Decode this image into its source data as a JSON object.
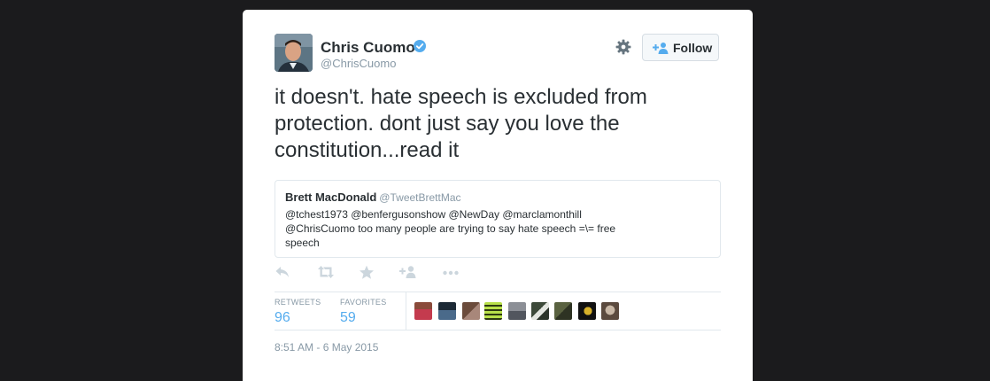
{
  "user": {
    "name": "Chris Cuomo",
    "handle": "@ChrisCuomo",
    "verified": true
  },
  "buttons": {
    "follow_label": "Follow"
  },
  "icons": {
    "settings": "gear-icon",
    "follow": "add-user-icon",
    "verified": "verified-badge-icon",
    "actions": [
      "reply-icon",
      "retweet-icon",
      "favorite-star-icon",
      "add-user-icon",
      "more-dots-icon"
    ]
  },
  "tweet": {
    "text": "it doesn't. hate speech is excluded from protection. dont just say you love the constitution...read it",
    "timestamp": "8:51 AM - 6 May 2015"
  },
  "quoted_tweet": {
    "name": "Brett MacDonald",
    "handle": "@TweetBrettMac",
    "text": "@tchest1973 @benfergusonshow @NewDay @marclamonthill @ChrisCuomo too many people are trying to say hate speech =\\= free speech"
  },
  "stats": {
    "retweets_label": "RETWEETS",
    "retweets": "96",
    "favorites_label": "FAVORITES",
    "favorites": "59"
  },
  "colors": {
    "background": "#1b1b1d",
    "card": "#ffffff",
    "accent": "#55acee",
    "text": "#292f33",
    "muted": "#8899a6",
    "border": "#e1e8ed"
  }
}
